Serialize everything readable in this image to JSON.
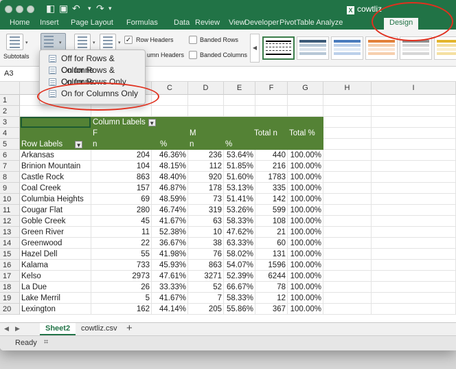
{
  "window": {
    "title": "cowtliz"
  },
  "ribbon_tabs": [
    "Home",
    "Insert",
    "Page Layout",
    "Formulas",
    "Data",
    "Review",
    "View",
    "Developer",
    "PivotTable Analyze",
    "Design"
  ],
  "active_tab": "Design",
  "ribbon": {
    "subtotals": "Subtotals",
    "row_headers": "Row Headers",
    "column_headers_partial": "umn Headers",
    "banded_rows": "Banded Rows",
    "banded_columns": "Banded Columns",
    "row_headers_checked": true,
    "column_headers_checked": true
  },
  "name_box": "A3",
  "dropdown_items": [
    "Off for Rows & Columns",
    "On for Rows & Columns",
    "On for Rows Only",
    "On for Columns Only"
  ],
  "columns": [
    "C",
    "D",
    "E",
    "F",
    "G",
    "H",
    "I"
  ],
  "pivot": {
    "column_labels": "Column Labels",
    "row_labels": "Row Labels",
    "f": "F",
    "m": "M",
    "n": "n",
    "pct": "%",
    "total_n": "Total n",
    "total_pct": "Total %"
  },
  "rows": [
    {
      "r": "6",
      "name": "Arkansas",
      "fn": "204",
      "fp": "46.36%",
      "mn": "236",
      "mp": "53.64%",
      "tn": "440",
      "tp": "100.00%"
    },
    {
      "r": "7",
      "name": "Brinion Mountain",
      "fn": "104",
      "fp": "48.15%",
      "mn": "112",
      "mp": "51.85%",
      "tn": "216",
      "tp": "100.00%"
    },
    {
      "r": "8",
      "name": "Castle Rock",
      "fn": "863",
      "fp": "48.40%",
      "mn": "920",
      "mp": "51.60%",
      "tn": "1783",
      "tp": "100.00%"
    },
    {
      "r": "9",
      "name": "Coal Creek",
      "fn": "157",
      "fp": "46.87%",
      "mn": "178",
      "mp": "53.13%",
      "tn": "335",
      "tp": "100.00%"
    },
    {
      "r": "10",
      "name": "Columbia Heights",
      "fn": "69",
      "fp": "48.59%",
      "mn": "73",
      "mp": "51.41%",
      "tn": "142",
      "tp": "100.00%"
    },
    {
      "r": "11",
      "name": "Cougar Flat",
      "fn": "280",
      "fp": "46.74%",
      "mn": "319",
      "mp": "53.26%",
      "tn": "599",
      "tp": "100.00%"
    },
    {
      "r": "12",
      "name": "Goble Creek",
      "fn": "45",
      "fp": "41.67%",
      "mn": "63",
      "mp": "58.33%",
      "tn": "108",
      "tp": "100.00%"
    },
    {
      "r": "13",
      "name": "Green River",
      "fn": "11",
      "fp": "52.38%",
      "mn": "10",
      "mp": "47.62%",
      "tn": "21",
      "tp": "100.00%"
    },
    {
      "r": "14",
      "name": "Greenwood",
      "fn": "22",
      "fp": "36.67%",
      "mn": "38",
      "mp": "63.33%",
      "tn": "60",
      "tp": "100.00%"
    },
    {
      "r": "15",
      "name": "Hazel Dell",
      "fn": "55",
      "fp": "41.98%",
      "mn": "76",
      "mp": "58.02%",
      "tn": "131",
      "tp": "100.00%"
    },
    {
      "r": "16",
      "name": "Kalama",
      "fn": "733",
      "fp": "45.93%",
      "mn": "863",
      "mp": "54.07%",
      "tn": "1596",
      "tp": "100.00%"
    },
    {
      "r": "17",
      "name": "Kelso",
      "fn": "2973",
      "fp": "47.61%",
      "mn": "3271",
      "mp": "52.39%",
      "tn": "6244",
      "tp": "100.00%"
    },
    {
      "r": "18",
      "name": "La Due",
      "fn": "26",
      "fp": "33.33%",
      "mn": "52",
      "mp": "66.67%",
      "tn": "78",
      "tp": "100.00%"
    },
    {
      "r": "19",
      "name": "Lake Merril",
      "fn": "5",
      "fp": "41.67%",
      "mn": "7",
      "mp": "58.33%",
      "tn": "12",
      "tp": "100.00%"
    },
    {
      "r": "20",
      "name": "Lexington",
      "fn": "162",
      "fp": "44.14%",
      "mn": "205",
      "mp": "55.86%",
      "tn": "367",
      "tp": "100.00%"
    }
  ],
  "sheets": [
    "Sheet2",
    "cowtliz.csv"
  ],
  "active_sheet": "Sheet2",
  "status": "Ready",
  "colors": {
    "excel_green": "#217346",
    "pivot_header": "#548235",
    "annotation": "#e0301e"
  }
}
